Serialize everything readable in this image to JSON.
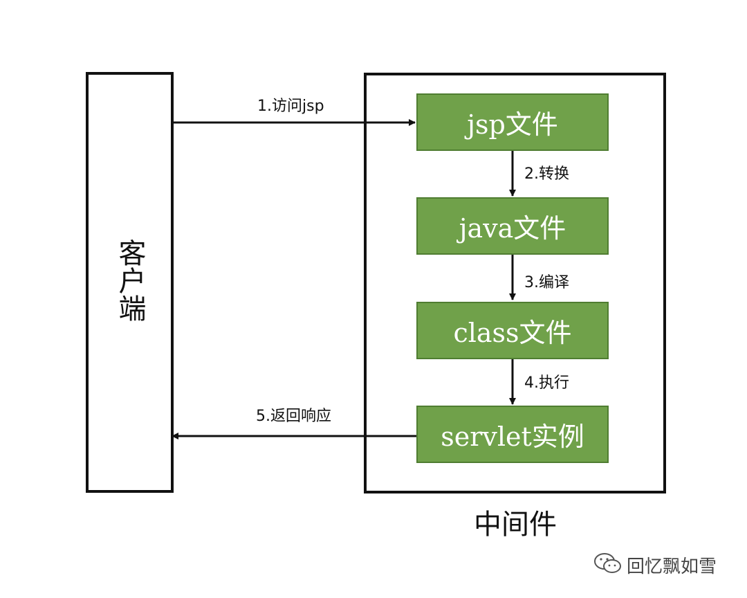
{
  "client_label": "客户端",
  "middleware_label": "中间件",
  "nodes": [
    {
      "label": "jsp文件"
    },
    {
      "label": "java文件"
    },
    {
      "label": "class文件"
    },
    {
      "label": "servlet实例"
    }
  ],
  "steps": [
    {
      "label": "1.访问jsp"
    },
    {
      "label": "2.转换"
    },
    {
      "label": "3.编译"
    },
    {
      "label": "4.执行"
    },
    {
      "label": "5.返回响应"
    }
  ],
  "watermark": {
    "text": "回忆飘如雪",
    "icon": "wechat-icon"
  },
  "colors": {
    "node_fill": "#70a14a",
    "node_border": "#4f7d31",
    "line": "#111111"
  }
}
